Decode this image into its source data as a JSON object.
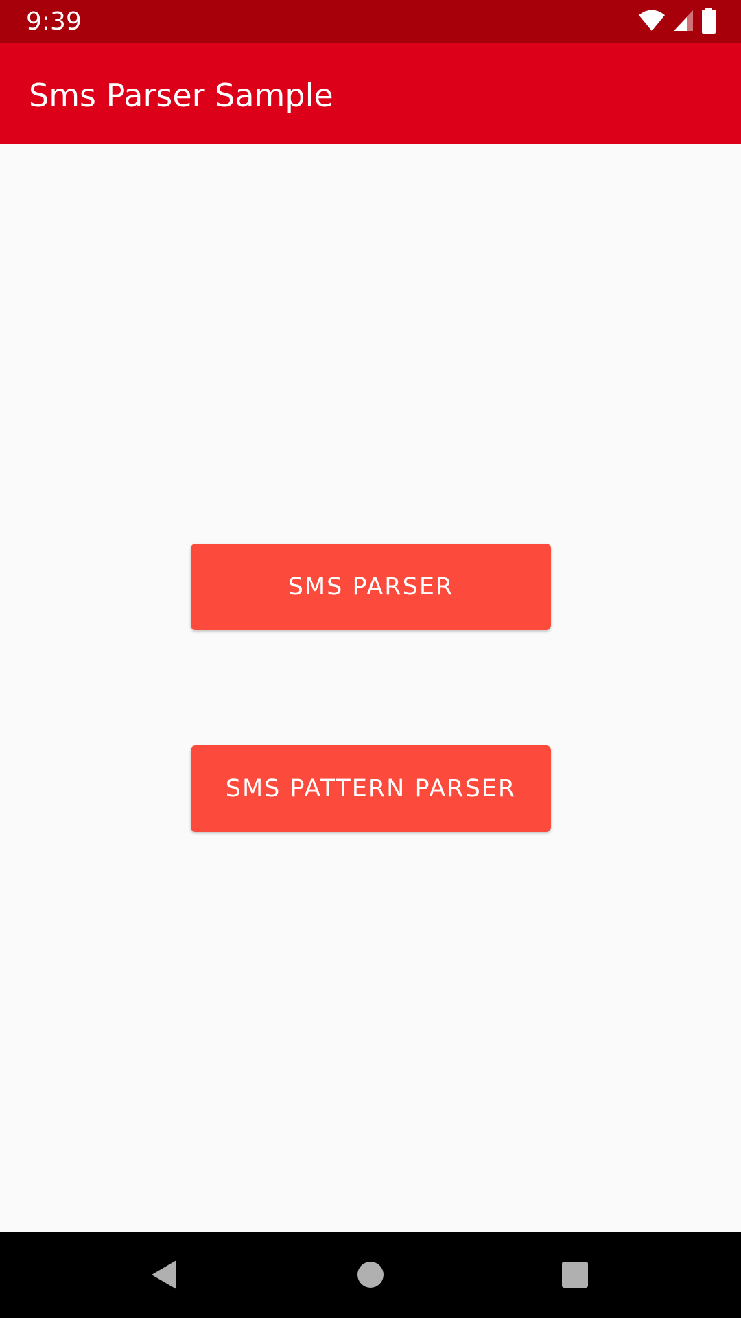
{
  "status_bar": {
    "time": "9:39",
    "icons": [
      "wifi-icon",
      "cell-signal-icon",
      "battery-icon"
    ]
  },
  "app_bar": {
    "title": "Sms Parser Sample"
  },
  "buttons": {
    "sms_parser": "SMS PARSER",
    "sms_pattern_parser": "SMS PATTERN PARSER"
  },
  "nav_bar": {
    "icons": [
      "back-icon",
      "home-icon",
      "recents-icon"
    ]
  },
  "colors": {
    "status_bar": "#a8000a",
    "app_bar": "#dd0019",
    "button": "#fc4b3c",
    "background": "#fafafa",
    "nav_bar": "#000000"
  }
}
